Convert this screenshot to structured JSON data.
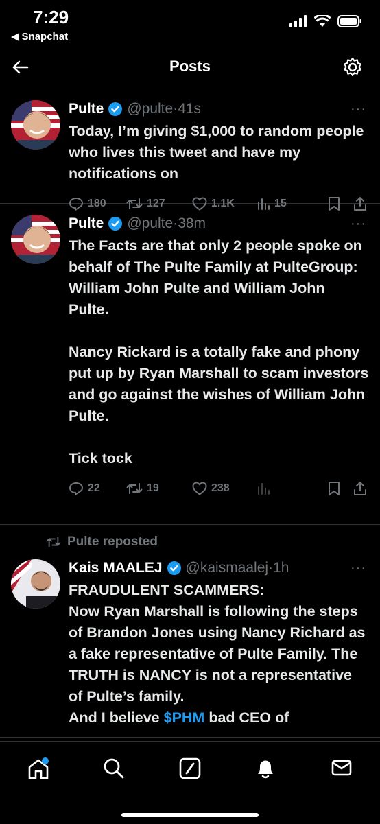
{
  "status_bar": {
    "time": "7:29",
    "back_app": "Snapchat"
  },
  "header": {
    "title": "Posts"
  },
  "posts": [
    {
      "name": "Pulte",
      "handle": "@pulte",
      "sep": "·",
      "time": "41s",
      "more": "···",
      "text": "Today, I’m giving $1,000 to random people who lives this tweet and have my notifications on",
      "replies": "180",
      "reposts": "127",
      "likes": "1.1K",
      "views": "15"
    },
    {
      "name": "Pulte",
      "handle": "@pulte",
      "sep": "·",
      "time": "38m",
      "more": "···",
      "text": "The Facts are that only 2 people spoke on behalf of The Pulte Family at PulteGroup: William John Pulte and William John Pulte.\n\nNancy Rickard is a totally fake and phony put up by Ryan Marshall to scam investors and go against the wishes of William John Pulte.\n\nTick tock",
      "replies": "22",
      "reposts": "19",
      "likes": "238",
      "views": ""
    },
    {
      "repost_label": "Pulte reposted",
      "name": "Kais MAALEJ",
      "handle": "@kaismaalej",
      "sep": "·",
      "time": "1h",
      "more": "···",
      "text": "FRAUDULENT SCAMMERS:\nNow Ryan Marshall is following the steps of Brandon Jones using Nancy Richard as a fake representative of Pulte Family. The TRUTH is NANCY is not a representative of Pulte’s family.\nAnd I believe ",
      "cashtag": "$PHM",
      "text_tail": " bad CEO of"
    }
  ],
  "colors": {
    "accent": "#1d9bf0",
    "muted": "#71767b",
    "background": "#000000"
  },
  "tabs": [
    "home-icon",
    "search-icon",
    "grok-icon",
    "notifications-icon",
    "messages-icon"
  ]
}
